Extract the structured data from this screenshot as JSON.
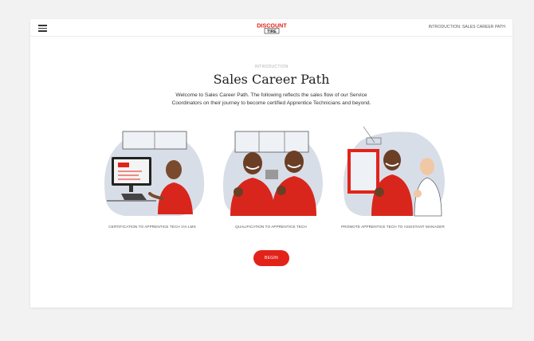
{
  "header": {
    "menu_icon": "hamburger-icon",
    "logo": {
      "line1": "DISCOUNT",
      "line2": "TIRE",
      "color": "#e2231a"
    },
    "breadcrumb": "INTRODUCTION: SALES CAREER PATH"
  },
  "intro": {
    "eyebrow": "INTRODUCTION",
    "title": "Sales Career Path",
    "description": "Welcome to Sales Career Path. The following reflects the sales flow of our Service Coordinators on their journey to become certified Apprentice Technicians and beyond."
  },
  "steps": [
    {
      "caption": "CERTIFICATION TO APPRENTICE TECH VIA LMS"
    },
    {
      "caption": "QUALIFICATION TO APPRENTICE TECH"
    },
    {
      "caption": "PROMOTE APPRENTICE TECH TO ASSISTANT MANAGER"
    }
  ],
  "cta": {
    "label": "BEGIN",
    "color": "#e2231a"
  }
}
